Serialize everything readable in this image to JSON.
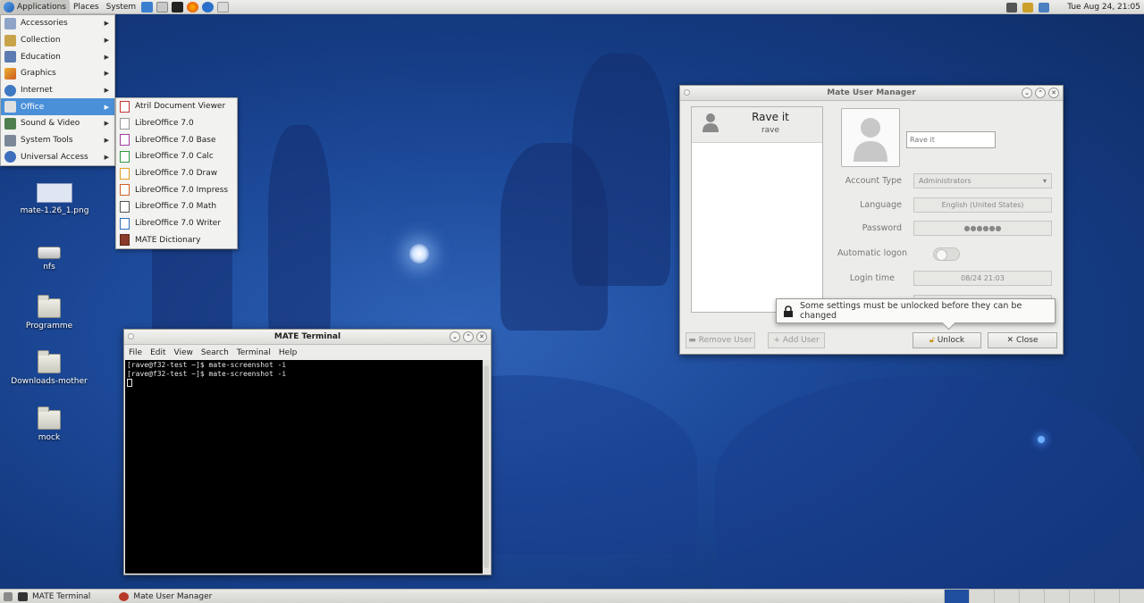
{
  "top_panel": {
    "menus": [
      "Applications",
      "Places",
      "System"
    ],
    "clock": "Tue Aug 24, 21:05"
  },
  "app_menu": {
    "items": [
      {
        "label": "Accessories",
        "icon": "accessories-icon"
      },
      {
        "label": "Collection",
        "icon": "collection-icon"
      },
      {
        "label": "Education",
        "icon": "education-icon"
      },
      {
        "label": "Graphics",
        "icon": "graphics-icon"
      },
      {
        "label": "Internet",
        "icon": "internet-icon"
      },
      {
        "label": "Office",
        "icon": "office-icon",
        "selected": true
      },
      {
        "label": "Sound & Video",
        "icon": "sound-video-icon"
      },
      {
        "label": "System Tools",
        "icon": "system-tools-icon"
      },
      {
        "label": "Universal Access",
        "icon": "universal-access-icon"
      }
    ],
    "office_submenu": [
      "Atril Document Viewer",
      "LibreOffice 7.0",
      "LibreOffice 7.0 Base",
      "LibreOffice 7.0 Calc",
      "LibreOffice 7.0 Draw",
      "LibreOffice 7.0 Impress",
      "LibreOffice 7.0 Math",
      "LibreOffice 7.0 Writer",
      "MATE Dictionary"
    ]
  },
  "desktop_icons": [
    {
      "label": "mate-1.26_1.png"
    },
    {
      "label": "nfs"
    },
    {
      "label": "Programme"
    },
    {
      "label": "Downloads-mother"
    },
    {
      "label": "mock"
    }
  ],
  "terminal": {
    "title": "MATE Terminal",
    "menu": [
      "File",
      "Edit",
      "View",
      "Search",
      "Terminal",
      "Help"
    ],
    "lines": [
      "[rave@f32-test ~]$ mate-screenshot -i",
      "[rave@f32-test ~]$ mate-screenshot -i"
    ]
  },
  "user_manager": {
    "title": "Mate User Manager",
    "user_display_name": "Rave it",
    "user_login": "rave",
    "name_field": "Rave it",
    "labels": {
      "account_type": "Account Type",
      "language": "Language",
      "password": "Password",
      "automatic_logon": "Automatic logon",
      "login_time": "Login time"
    },
    "values": {
      "account_type": "Administrators",
      "language": "English (United States)",
      "password": "●●●●●●",
      "login_time": "08/24 21:03"
    },
    "buttons": {
      "remove_user": "Remove User",
      "add_user": "Add User",
      "unlock": "Unlock",
      "close": "Close"
    },
    "tooltip": "Some settings must be unlocked before they can be changed"
  },
  "taskbar": {
    "tasks": [
      "MATE Terminal",
      "Mate User Manager"
    ]
  }
}
